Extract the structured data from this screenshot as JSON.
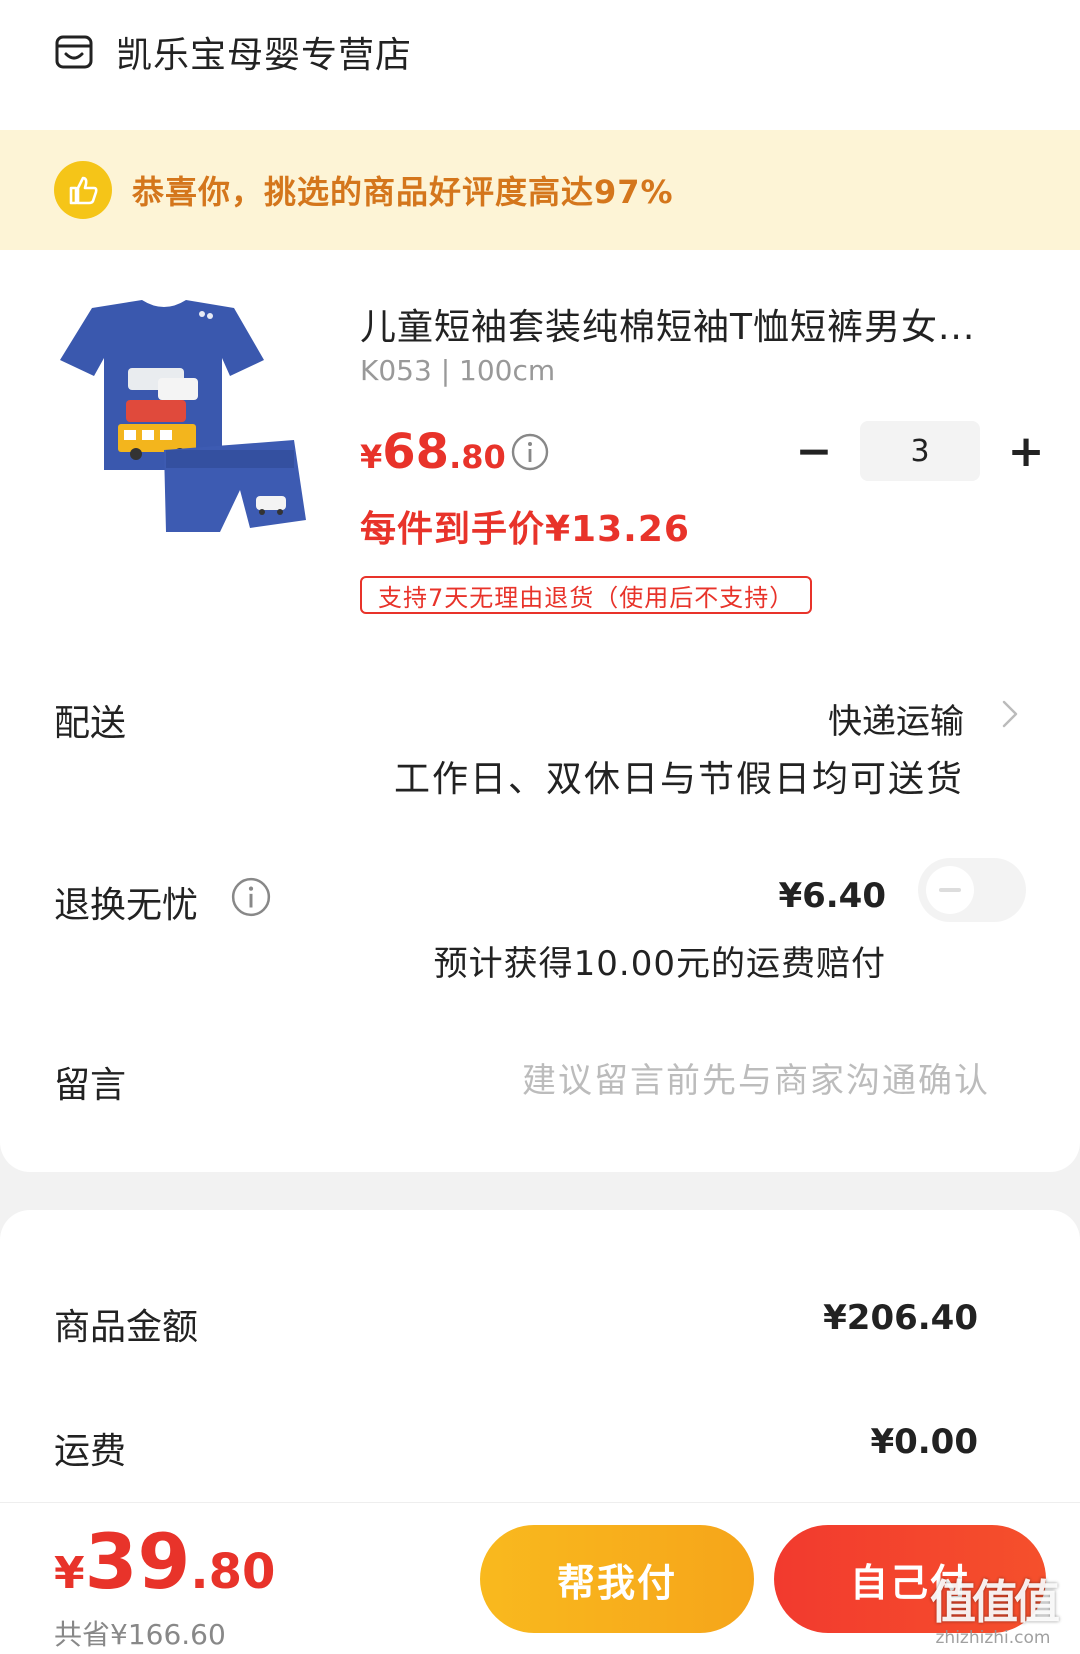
{
  "shop": {
    "name": "凯乐宝母婴专营店",
    "icon": "shop-icon"
  },
  "banner": {
    "text": "恭喜你，挑选的商品好评度高达97%",
    "icon": "thumbs-up-icon"
  },
  "product": {
    "title": "儿童短袖套装纯棉短袖T恤短裤男女...",
    "spec": "K053 | 100cm",
    "price_symbol": "¥",
    "price_int": "68",
    "price_dec": ".80",
    "unit_price": "每件到手价¥13.26",
    "return_tag": "支持7天无理由退货（使用后不支持）",
    "quantity": "3",
    "minus": "−",
    "plus": "+"
  },
  "delivery": {
    "label": "配送",
    "method": "快递运输",
    "note": "工作日、双休日与节假日均可送货"
  },
  "insurance": {
    "label": "退换无忧",
    "price": "¥6.40",
    "note": "预计获得10.00元的运费赔付",
    "enabled": false
  },
  "message": {
    "label": "留言",
    "placeholder": "建议留言前先与商家沟通确认"
  },
  "summary": {
    "goods_label": "商品金额",
    "goods_value": "¥206.40",
    "shipping_label": "运费",
    "shipping_value": "¥0.00"
  },
  "footer": {
    "total_symbol": "¥",
    "total_int": "39",
    "total_dec": ".80",
    "saved": "共省¥166.60",
    "help_pay": "帮我付",
    "self_pay": "自己付"
  },
  "watermark": {
    "logo": "值值值",
    "url": "zhizhizhi.com"
  },
  "colors": {
    "accent_red": "#e8332a",
    "accent_yellow": "#f9b91e",
    "banner_bg": "#fdf4d6"
  }
}
